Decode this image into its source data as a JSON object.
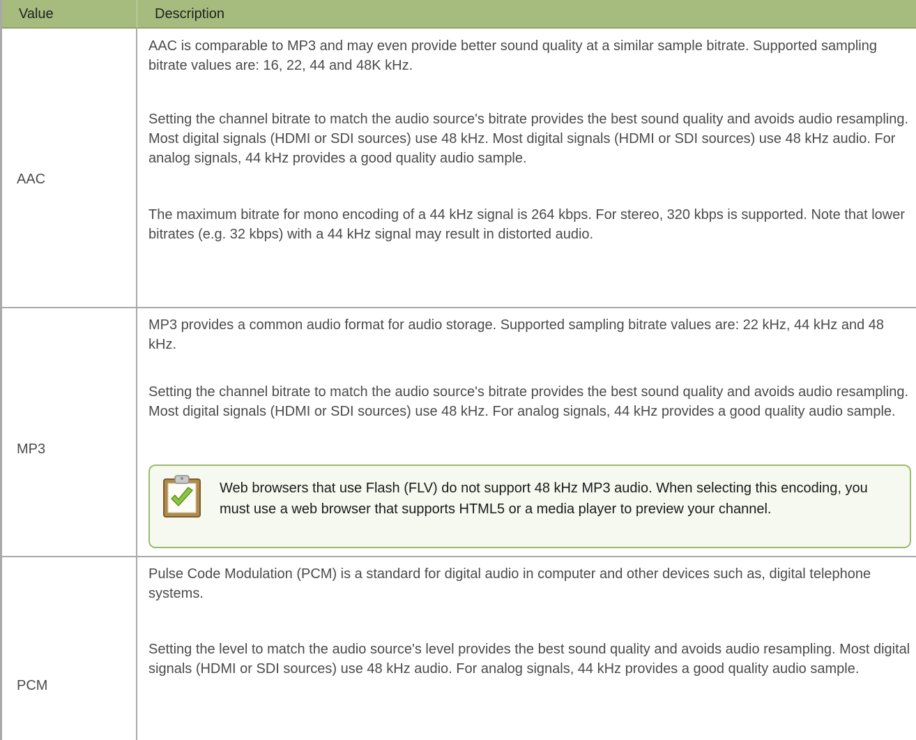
{
  "table": {
    "headers": {
      "value": "Value",
      "description": "Description"
    },
    "rows": [
      {
        "value": "AAC",
        "paragraphs": [
          "AAC is comparable to MP3 and may even provide better sound quality at a similar sample bitrate. Supported sampling bitrate values are: 16, 22, 44 and 48K kHz.",
          "Setting the channel bitrate to match the audio source's bitrate provides the best sound quality and avoids audio resampling. Most digital signals (HDMI or SDI sources) use 48 kHz. Most digital signals (HDMI or SDI sources) use 48 kHz audio. For analog signals, 44 kHz provides a good quality audio sample.",
          "The maximum bitrate for mono encoding of a 44 kHz signal is 264 kbps. For stereo, 320 kbps is supported. Note that lower bitrates (e.g. 32 kbps) with a 44 kHz signal may result in distorted audio."
        ]
      },
      {
        "value": "MP3",
        "paragraphs": [
          "MP3 provides a common audio format for audio storage. Supported sampling bitrate values are: 22 kHz, 44 kHz and 48 kHz.",
          "Setting the channel bitrate to match the audio source's bitrate provides the best sound quality and avoids audio resampling. Most digital signals (HDMI or SDI sources) use 48 kHz. For analog signals, 44 kHz provides a good quality audio sample."
        ],
        "note": {
          "icon": "clipboard-check-icon",
          "text": "Web browsers that use Flash (FLV) do not support 48 kHz MP3 audio. When selecting this encoding, you must use a web browser that supports HTML5 or a media player to preview your channel."
        }
      },
      {
        "value": "PCM",
        "paragraphs": [
          "Pulse Code Modulation (PCM) is a standard for digital audio in computer and other devices such as, digital telephone systems.",
          "Setting the level to match the audio source's level provides the best sound quality and avoids audio resampling. Most digital signals (HDMI or SDI sources) use 48 kHz audio. For analog signals, 44 kHz provides a good quality audio sample."
        ]
      }
    ]
  },
  "colors": {
    "header_bg": "#a6bc7e",
    "border": "#a9a9a9",
    "note_border": "#9cb96c",
    "note_bg": "#f6f9ef",
    "text": "#4a4a4a"
  }
}
